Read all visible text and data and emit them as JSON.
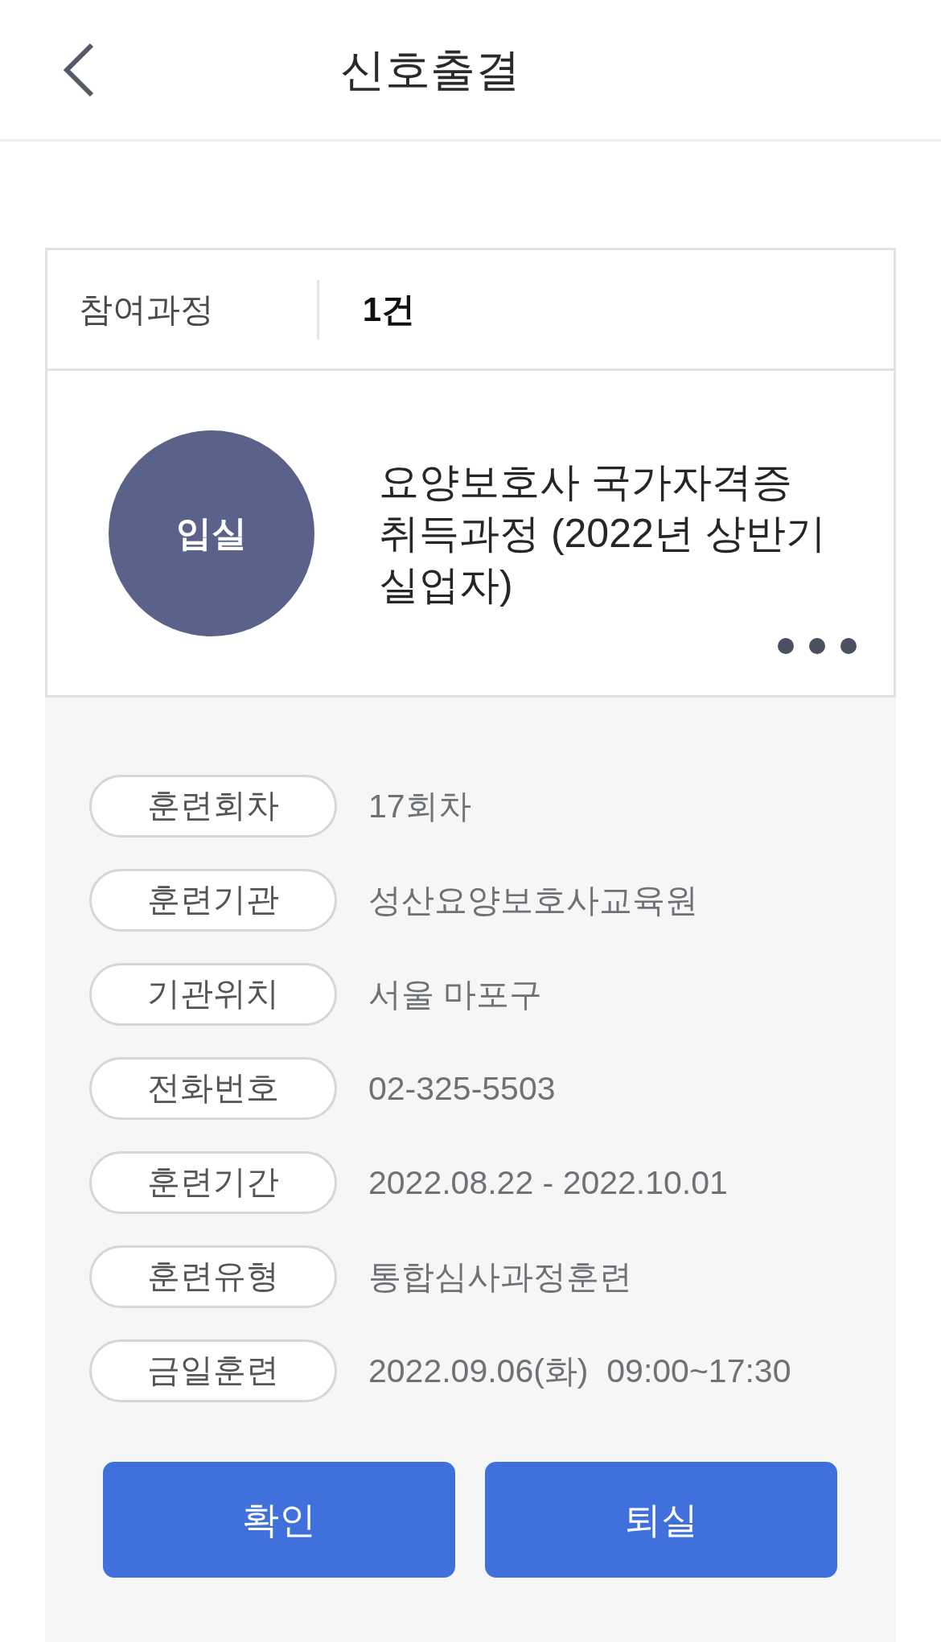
{
  "header": {
    "title": "신호출결"
  },
  "summary": {
    "label": "참여과정",
    "value": "1건"
  },
  "course": {
    "status": "입실",
    "title": "요양보호사 국가자격증 취득과정 (2022년 상반기 실업자)"
  },
  "details": [
    {
      "label": "훈련회차",
      "value": "17회차"
    },
    {
      "label": "훈련기관",
      "value": "성산요양보호사교육원"
    },
    {
      "label": "기관위치",
      "value": "서울 마포구"
    },
    {
      "label": "전화번호",
      "value": "02-325-5503"
    },
    {
      "label": "훈련기간",
      "value": "2022.08.22 - 2022.10.01"
    },
    {
      "label": "훈련유형",
      "value": "통합심사과정훈련"
    },
    {
      "label": "금일훈련",
      "value": "2022.09.06(화)  09:00~17:30"
    }
  ],
  "buttons": [
    {
      "label": "확인"
    },
    {
      "label": "퇴실"
    }
  ]
}
